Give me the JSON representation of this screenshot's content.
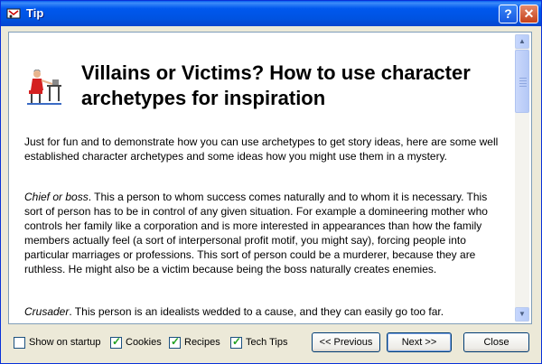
{
  "window": {
    "title": "Tip"
  },
  "tip": {
    "heading": "Villains or Victims? How to use character archetypes for inspiration",
    "paragraphs": [
      {
        "italic": "",
        "text": "Just for fun and to demonstrate how you can use archetypes to get story ideas, here are some well established character archetypes and some ideas how you might use them in a mystery."
      },
      {
        "italic": "Chief or boss",
        "text": ". This a person to whom success comes naturally and to whom it is necessary. This sort of person has to be in control of any given situation. For example a domineering mother who controls her family like a corporation and is more interested in appearances than how the family members actually feel (a sort of interpersonal profit motif, you might say), forcing people into particular marriages or professions. This sort of person could be a murderer, because they are ruthless. He might also be a victim because being the boss naturally creates enemies."
      },
      {
        "italic": "Crusader",
        "text": ". This person is an idealists wedded to a cause, and they can easily go too far."
      }
    ]
  },
  "options": [
    {
      "label": "Show on startup",
      "checked": false
    },
    {
      "label": "Cookies",
      "checked": true
    },
    {
      "label": "Recipes",
      "checked": true
    },
    {
      "label": "Tech Tips",
      "checked": true
    }
  ],
  "buttons": {
    "previous": "<< Previous",
    "next": "Next >>",
    "close": "Close"
  },
  "titlebar_icons": {
    "help": "?",
    "close": "✕"
  }
}
